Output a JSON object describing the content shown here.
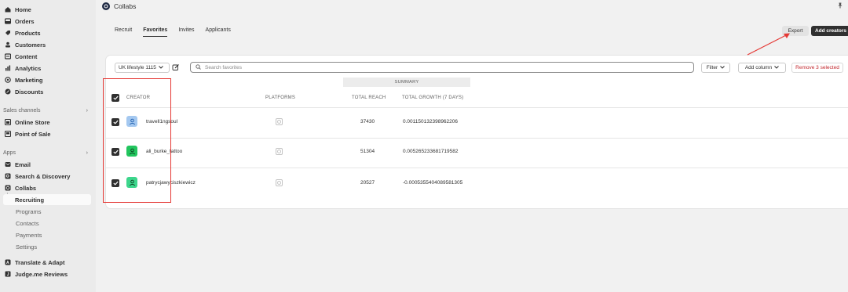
{
  "sidebar": {
    "main_items": [
      {
        "label": "Home",
        "icon": "home-icon"
      },
      {
        "label": "Orders",
        "icon": "orders-icon"
      },
      {
        "label": "Products",
        "icon": "tag-icon"
      },
      {
        "label": "Customers",
        "icon": "person-icon"
      },
      {
        "label": "Content",
        "icon": "content-icon"
      },
      {
        "label": "Analytics",
        "icon": "chart-icon"
      },
      {
        "label": "Marketing",
        "icon": "target-icon"
      },
      {
        "label": "Discounts",
        "icon": "discount-icon"
      }
    ],
    "sales_channels_label": "Sales channels",
    "sales_channels": [
      {
        "label": "Online Store",
        "icon": "store-icon"
      },
      {
        "label": "Point of Sale",
        "icon": "pos-icon"
      }
    ],
    "apps_label": "Apps",
    "apps": [
      {
        "label": "Email",
        "icon": "email-icon"
      },
      {
        "label": "Search & Discovery",
        "icon": "search-discovery-icon"
      },
      {
        "label": "Collabs",
        "icon": "collabs-icon"
      }
    ],
    "collabs_sub": [
      "Recruiting",
      "Programs",
      "Contacts",
      "Payments",
      "Settings"
    ],
    "more_apps": [
      {
        "label": "Translate & Adapt",
        "icon": "translate-icon"
      },
      {
        "label": "Judge.me Reviews",
        "icon": "judgeme-icon"
      }
    ]
  },
  "header": {
    "app_title": "Collabs"
  },
  "tabs": [
    "Recruit",
    "Favorites",
    "Invites",
    "Applicants"
  ],
  "active_tab": "Favorites",
  "actions": {
    "export": "Export",
    "add_creators": "Add creators"
  },
  "toolbar": {
    "view_name": "UK lifestyle 1115",
    "search_placeholder": "Search favorites",
    "filter": "Filter",
    "add_column": "Add column",
    "remove_selected": "Remove 3 selected"
  },
  "table": {
    "summary_label": "SUMMARY",
    "headers": {
      "creator": "CREATOR",
      "platforms": "PLATFORMS",
      "total_reach": "TOTAL REACH",
      "total_growth": "TOTAL GROWTH (7 DAYS)"
    },
    "rows": [
      {
        "creator": "travell1ngsoul",
        "reach": "37430",
        "growth": "0.001150132398962206",
        "avatar_color": "#a4c8f0",
        "selected": true
      },
      {
        "creator": "ali_burke_tattoo",
        "reach": "51304",
        "growth": "0.005265233681719582",
        "avatar_color": "#22c55e",
        "selected": true
      },
      {
        "creator": "patrycjawyciszkiewicz",
        "reach": "20527",
        "growth": "-0.0005355404089581305",
        "avatar_color": "#3dd68c",
        "selected": true
      }
    ]
  },
  "colors": {
    "accent_dark": "#303030",
    "annotation_red": "#e53935",
    "remove_red": "#c2272d"
  }
}
